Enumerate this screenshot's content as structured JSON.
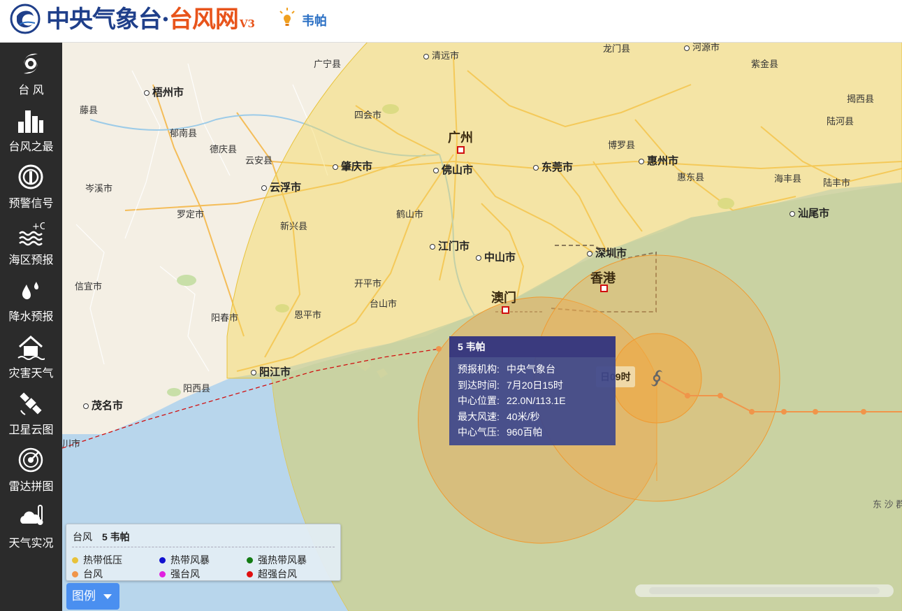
{
  "header": {
    "brand_part1": "中央气象台",
    "brand_sep": "·",
    "brand_part2": "台风网",
    "version": "V3",
    "storm_name": "韦帕"
  },
  "sidebar": {
    "items": [
      {
        "label": "台 风",
        "icon": "typhoon-icon"
      },
      {
        "label": "台风之最",
        "icon": "bar-chart-icon"
      },
      {
        "label": "预警信号",
        "icon": "warning-signal-icon"
      },
      {
        "label": "海区预报",
        "icon": "sea-forecast-icon"
      },
      {
        "label": "降水预报",
        "icon": "rain-drop-icon"
      },
      {
        "label": "灾害天气",
        "icon": "disaster-house-icon"
      },
      {
        "label": "卫星云图",
        "icon": "satellite-icon"
      },
      {
        "label": "雷达拼图",
        "icon": "radar-icon"
      },
      {
        "label": "天气实况",
        "icon": "cloud-thermometer-icon"
      }
    ]
  },
  "map": {
    "places": {
      "qingyuan": "清远市",
      "longmen": "龙门县",
      "heyuan": "河源市",
      "zijin": "紫金县",
      "guangning": "广宁县",
      "wuzhou": "梧州市",
      "jiexi": "揭西县",
      "teng": "藤县",
      "sihui": "四会市",
      "guangzhou": "广州",
      "luhe": "陆河县",
      "cenxi_n": "郁南县",
      "deqing": "德庆县",
      "boluo": "博罗县",
      "yunan2": "云安县",
      "zhaoqing": "肇庆市",
      "foshan": "佛山市",
      "dongguan": "东莞市",
      "huizhou": "惠州市",
      "huidong": "惠东县",
      "haifeng": "海丰县",
      "lufeng": "陆丰市",
      "cenxi": "岑溪市",
      "yunfu": "云浮市",
      "luoding": "罗定市",
      "heshan": "鹤山市",
      "shanwei": "汕尾市",
      "xinxing": "新兴县",
      "jiangmen": "江门市",
      "zhongshan": "中山市",
      "shenzhen": "深圳市",
      "xinyi": "信宜市",
      "kaiping": "开平市",
      "hongkong": "香港",
      "taishan": "台山市",
      "macau": "澳门",
      "yangchun": "阳春市",
      "enping": "恩平市",
      "yangjiang": "阳江市",
      "yangxi": "阳西县",
      "maoming": "茂名市",
      "lianjiang": "川市",
      "dongsha": "东 沙 群"
    }
  },
  "tooltip": {
    "title": "5 韦帕",
    "rows": [
      {
        "key": "预报机构:",
        "value": "中央气象台"
      },
      {
        "key": "到达时间:",
        "value": "7月20日15时"
      },
      {
        "key": "中心位置:",
        "value": "22.0N/113.1E"
      },
      {
        "key": "最大风速:",
        "value": "40米/秒"
      },
      {
        "key": "中心气压:",
        "value": "960百帕"
      }
    ]
  },
  "time_tag": "日09时",
  "legend": {
    "category": "台风",
    "storm": "5 韦帕",
    "items": [
      {
        "label": "热带低压",
        "color": "#e8c23a"
      },
      {
        "label": "热带风暴",
        "color": "#1010d0"
      },
      {
        "label": "强热带风暴",
        "color": "#137b13"
      },
      {
        "label": "台风",
        "color": "#f0954a"
      },
      {
        "label": "强台风",
        "color": "#e020e0"
      },
      {
        "label": "超强台风",
        "color": "#e01010"
      }
    ],
    "button_label": "图例"
  },
  "colors": {
    "sidebar_bg": "#2b2b2b",
    "brand_blue": "#1f3f8a",
    "brand_orange": "#e8541b",
    "tooltip_bg": "#3d478c",
    "track_orange": "#f0954a"
  }
}
